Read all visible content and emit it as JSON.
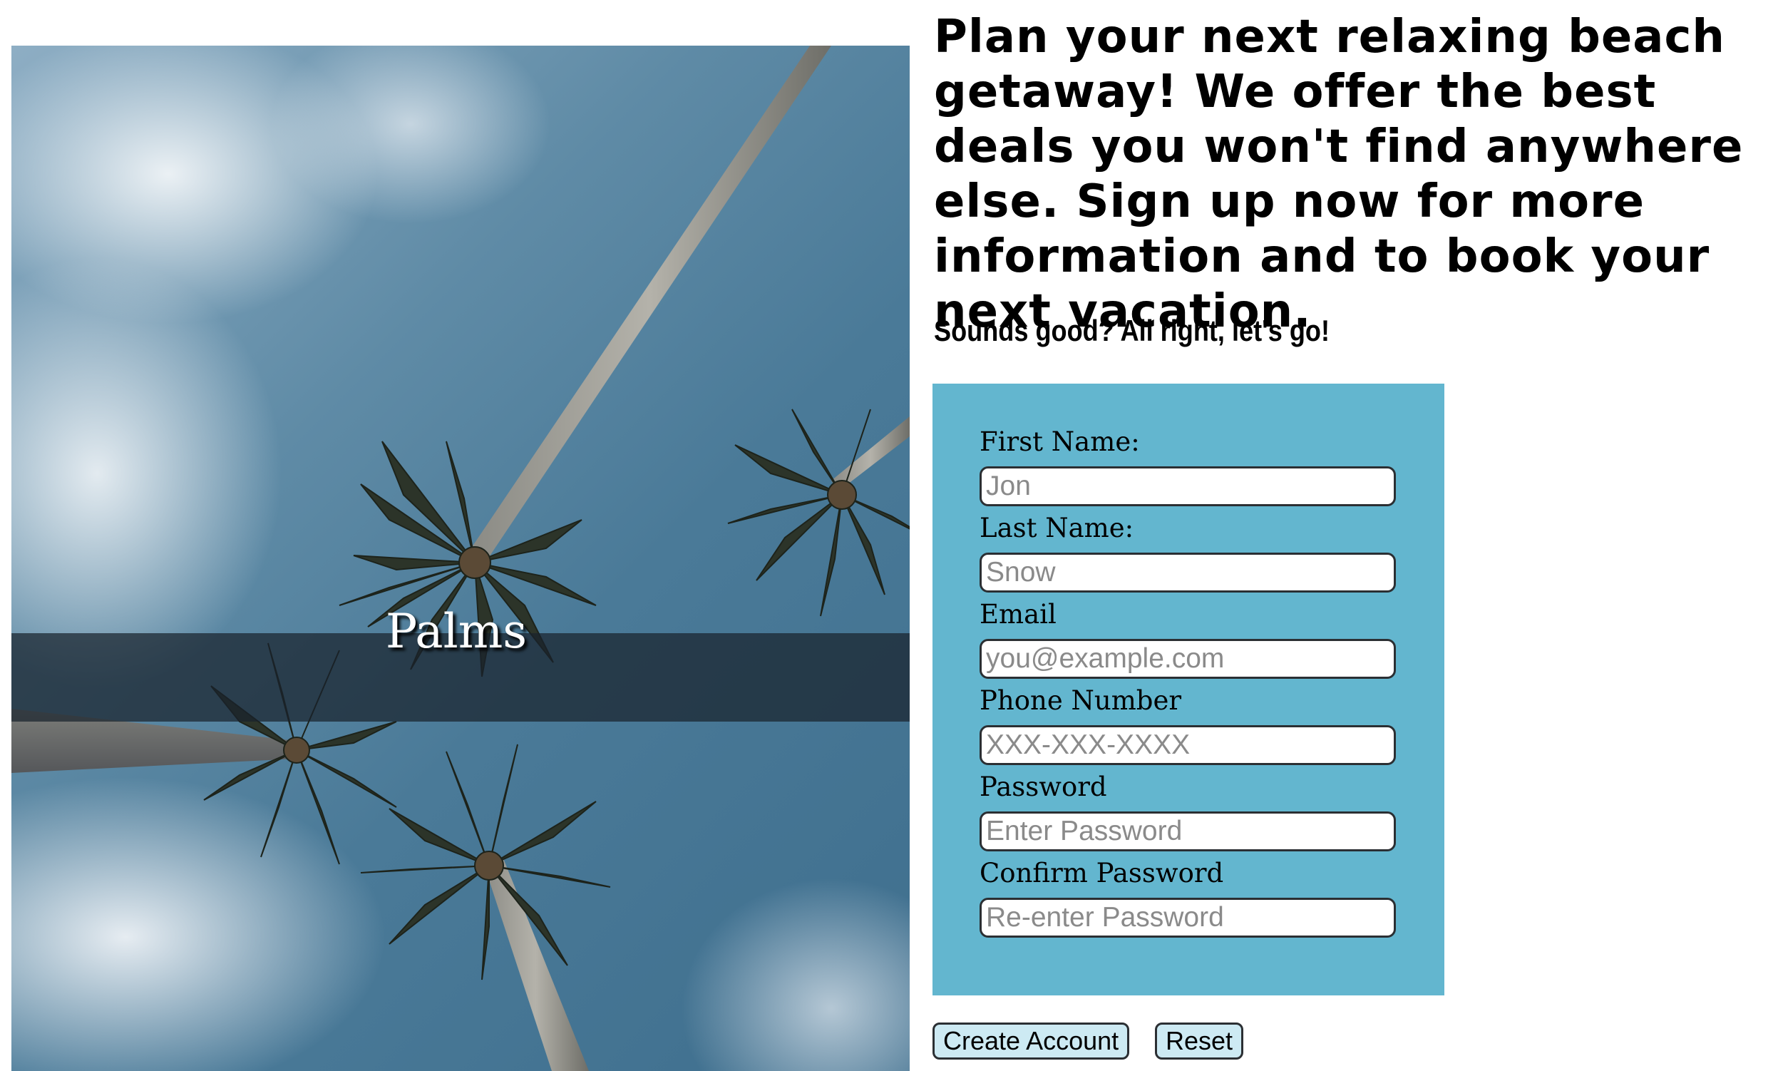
{
  "hero": {
    "caption": "Palms"
  },
  "intro": {
    "headline": "Plan your next relaxing beach getaway! We offer the best deals you won't find anywhere else. Sign up now for more information and to book your next vacation.",
    "subheading": "Sounds good? All right, let's go!"
  },
  "form": {
    "background_color": "#63b6cf",
    "fields": [
      {
        "label": "First Name:",
        "placeholder": "Jon"
      },
      {
        "label": "Last Name:",
        "placeholder": "Snow"
      },
      {
        "label": "Email",
        "placeholder": "you@example.com"
      },
      {
        "label": "Phone Number",
        "placeholder": "XXX-XXX-XXXX"
      },
      {
        "label": "Password",
        "placeholder": "Enter Password"
      },
      {
        "label": "Confirm Password",
        "placeholder": "Re-enter Password"
      }
    ],
    "buttons": {
      "create_label": "Create Account",
      "reset_label": "Reset"
    }
  }
}
